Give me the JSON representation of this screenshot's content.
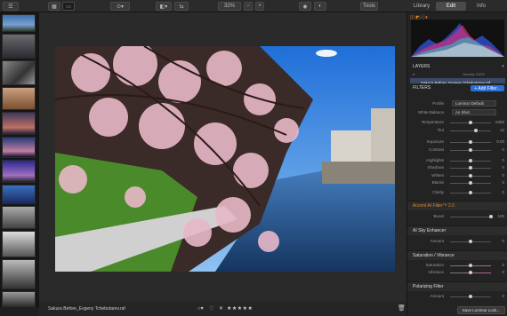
{
  "toolbar": {
    "zoom": "32%",
    "tools_label": "Tools",
    "tabs": [
      "Library",
      "Edit",
      "Info"
    ]
  },
  "photo": {
    "filename": "Sakura Before_Evgeny Tchebotarev.raf"
  },
  "layers": {
    "title": "LAYERS",
    "opacity": "Opacity 100%",
    "layer_name": "Sakura Before_Evgeny Tchebotarev.raf"
  },
  "filters": {
    "title": "FILTERS",
    "add_filter": "+ Add Filter..."
  },
  "profile": {
    "label": "Profile",
    "value": "Luminar Default"
  },
  "white_balance": {
    "label": "White Balance",
    "value": "As Shot"
  },
  "sliders1": [
    {
      "label": "Temperature",
      "value": "5356"
    },
    {
      "label": "Tint",
      "value": "12"
    },
    {
      "label": "Exposure",
      "value": "0.00"
    },
    {
      "label": "Contrast",
      "value": "0"
    },
    {
      "label": "Highlights",
      "value": "0"
    },
    {
      "label": "Shadows",
      "value": "0"
    },
    {
      "label": "Whites",
      "value": "0"
    },
    {
      "label": "Blacks",
      "value": "0"
    },
    {
      "label": "Clarity",
      "value": "0"
    }
  ],
  "accent": {
    "title": "Accent AI Filter™ 2.0",
    "label": "Boost",
    "value": "100"
  },
  "sky": {
    "title": "AI Sky Enhancer",
    "label": "Amount",
    "value": "0"
  },
  "satvib": {
    "title": "Saturation / Vibrance",
    "sat_label": "Saturation",
    "sat_value": "0",
    "vib_label": "Vibrance",
    "vib_value": "0"
  },
  "polar": {
    "title": "Polarizing Filter",
    "label": "Amount",
    "value": "0"
  },
  "save_look": "Save Luminar Look...",
  "colors": {
    "accent_blue": "#2a6fd6",
    "accent_orange": "#e08a2a"
  }
}
